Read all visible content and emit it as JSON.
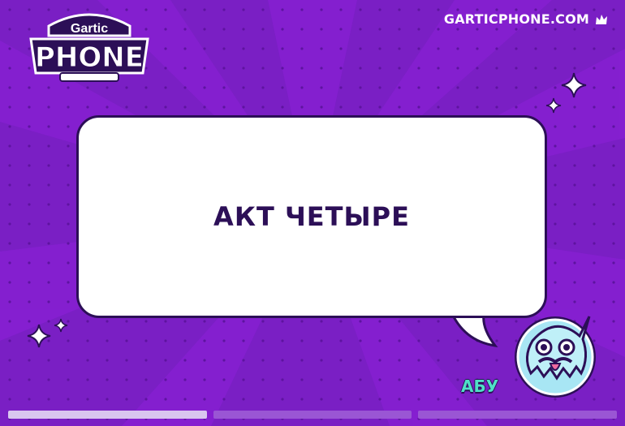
{
  "brand": {
    "logo_top": "Gartic",
    "logo_main": "PHONE",
    "site": "GARTICPHONE.COM"
  },
  "round": {
    "title": "АКТ ЧЕТЫРЕ"
  },
  "player": {
    "name": "АБУ",
    "avatar_icon": "ghost-avatar-icon"
  },
  "progress": {
    "segments": 3,
    "current": 1
  },
  "colors": {
    "background": "#7a1fc4",
    "background_ray": "#861fd1",
    "text_dark": "#2c0f57",
    "player_name": "#4fe0c7",
    "progress_done": "#d9c6ef",
    "progress_todo": "#9a56d4"
  }
}
